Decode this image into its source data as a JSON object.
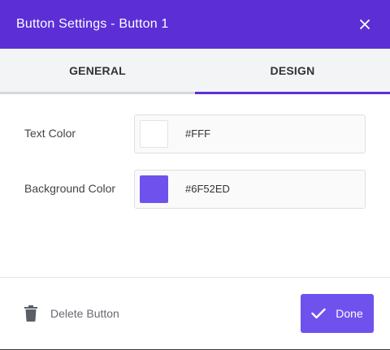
{
  "dialog": {
    "title": "Button Settings - Button 1",
    "close_icon": "close-icon"
  },
  "tabs": [
    {
      "label": "GENERAL",
      "active": false
    },
    {
      "label": "DESIGN",
      "active": true
    }
  ],
  "fields": {
    "text_color": {
      "label": "Text Color",
      "value": "#FFF",
      "swatch": "#ffffff"
    },
    "background_color": {
      "label": "Background Color",
      "value": "#6F52ED",
      "swatch": "#6f52ed"
    }
  },
  "footer": {
    "delete_label": "Delete Button",
    "delete_icon": "trash-icon",
    "done_label": "Done",
    "done_icon": "check-icon"
  },
  "colors": {
    "header": "#5c2fd6",
    "accent": "#6f52ed"
  }
}
